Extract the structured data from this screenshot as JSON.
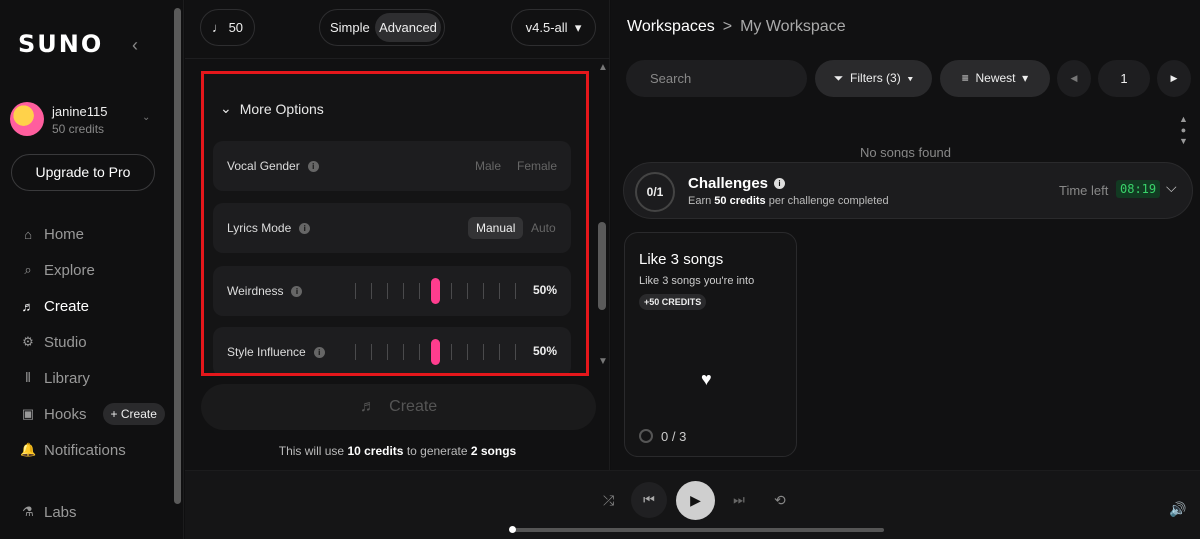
{
  "app": {
    "logo": "SUNO",
    "collapse": "‹"
  },
  "user": {
    "name": "janine115",
    "credits": "50 credits",
    "caret": "⌄"
  },
  "upgrade_label": "Upgrade to Pro",
  "nav": [
    {
      "label": "Home",
      "icon": "⌂",
      "active": false
    },
    {
      "label": "Explore",
      "icon": "⌕",
      "active": false
    },
    {
      "label": "Create",
      "icon": "♬",
      "active": true
    },
    {
      "label": "Studio",
      "icon": "⚙",
      "active": false
    },
    {
      "label": "Library",
      "icon": "⦀",
      "active": false
    },
    {
      "label": "Hooks",
      "icon": "▣",
      "active": false
    },
    {
      "label": "Notifications",
      "icon": "🔔",
      "active": false
    },
    {
      "label": "Labs",
      "icon": "⚗",
      "active": false
    }
  ],
  "hooks_create_label": "+ Create",
  "create": {
    "credit_count": "50",
    "mode_simple": "Simple",
    "mode_advanced": "Advanced",
    "version": "v4.5-all",
    "more_options": "More Options",
    "vocal_gender": {
      "label": "Vocal Gender",
      "opt1": "Male",
      "opt2": "Female"
    },
    "lyrics_mode": {
      "label": "Lyrics Mode",
      "selected": "Manual",
      "other": "Auto"
    },
    "weirdness": {
      "label": "Weirdness",
      "value": "50%",
      "level": 0.5
    },
    "style_influence": {
      "label": "Style Influence",
      "value": "50%",
      "level": 0.5
    },
    "create_button": "Create",
    "note_prefix": "This will use ",
    "note_credits": "10 credits",
    "note_mid": " to generate ",
    "note_songs": "2 songs"
  },
  "workspace": {
    "root": "Workspaces",
    "sep": ">",
    "current": "My Workspace",
    "search_placeholder": "Search",
    "filters": "Filters (3)",
    "sort": "Newest",
    "page": "1",
    "empty": "No songs found"
  },
  "challenges": {
    "progress": "0/1",
    "title": "Challenges",
    "sub_prefix": "Earn ",
    "sub_credits": "50 credits",
    "sub_suffix": " per challenge completed",
    "time_left": "Time left",
    "timer": "08:19"
  },
  "task": {
    "title": "Like 3 songs",
    "subtitle": "Like 3 songs you're into",
    "badge": "+50 CREDITS",
    "progress": "0 / 3"
  },
  "colors": {
    "accent": "#ff3d8e",
    "highlight_border": "#e5171b",
    "timer_green": "#39d36a"
  }
}
